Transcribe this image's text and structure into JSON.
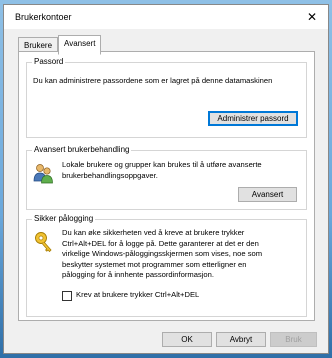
{
  "window": {
    "title": "Brukerkontoer",
    "close_glyph": "✕"
  },
  "tabs": [
    {
      "label": "Brukere",
      "active": false
    },
    {
      "label": "Avansert",
      "active": true
    }
  ],
  "password_section": {
    "label": "Passord",
    "description": "Du kan administrere passordene som er lagret på denne datamaskinen",
    "button": "Administrer passord"
  },
  "advanced_section": {
    "label": "Avansert brukerbehandling",
    "description_line1": "Lokale brukere og grupper kan brukes til å utføre avanserte",
    "description_line2": "brukerbehandlingsoppgaver.",
    "button": "Avansert",
    "icon": "users-group-icon"
  },
  "secure_logon_section": {
    "label": "Sikker pålogging",
    "line1": "Du kan øke sikkerheten ved å kreve at brukere trykker",
    "line2": "Ctrl+Alt+DEL for å logge på. Dette garanterer at det er den",
    "line3": "virkelige Windows-påloggingsskjermen som vises, noe som",
    "line4": "beskytter systemet mot programmer som etterligner en",
    "line5": "pålogging for å innhente passordinformasjon.",
    "checkbox_label": "Krev at brukere trykker Ctrl+Alt+DEL",
    "checkbox_checked": false,
    "icon": "key-icon"
  },
  "footer": {
    "ok": "OK",
    "cancel": "Avbryt",
    "apply": "Bruk"
  }
}
